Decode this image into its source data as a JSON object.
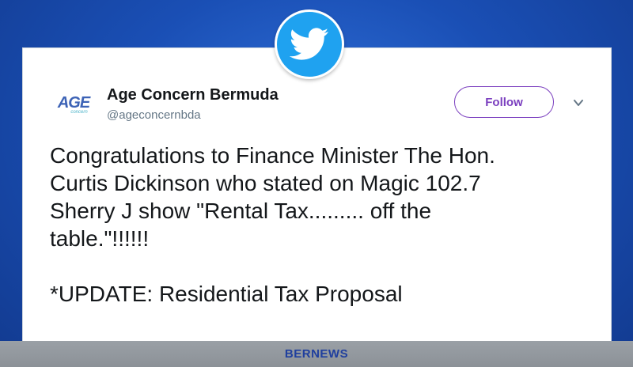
{
  "badge": {
    "icon": "twitter-bird-icon",
    "color": "#1fa2f0"
  },
  "account": {
    "avatar_text": "AGE",
    "avatar_subtext": "concern",
    "display_name": "Age Concern Bermuda",
    "handle": "@ageconcernbda"
  },
  "actions": {
    "follow_label": "Follow",
    "menu_icon": "chevron-down-icon",
    "follow_color": "#7b3fbf"
  },
  "tweet": {
    "text": "Congratulations to Finance Minister The Hon.\nCurtis Dickinson who stated on Magic 102.7\nSherry J show \"Rental Tax......... off the\ntable.\"!!!!!!\n\n*UPDATE: Residential Tax Proposal"
  },
  "footer": {
    "brand": "BERNEWS"
  }
}
